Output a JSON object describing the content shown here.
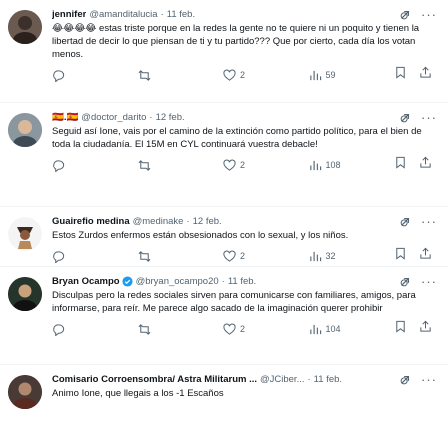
{
  "tweets": [
    {
      "name": "jennifer",
      "handle": "@amanditalucia",
      "date": "11 feb.",
      "text": "😂😂😂😂 estas triste porque en la redes la gente no te quiere ni un poquito y tienen la libertad de decir lo que piensan de ti y tu partido??? Que por cierto, cada día los votan menos.",
      "replies": "",
      "retweets": "",
      "likes": "2",
      "views": "59"
    },
    {
      "name": "🇪🇸.🇪🇸",
      "handle": "@doctor_darito",
      "date": "12 feb.",
      "text": "Seguid así Ione, vais por el camino de la extinción como partido político, para el bien de toda la ciudadanía. El 15M en CYL continuará vuestra debacle!",
      "replies": "",
      "retweets": "",
      "likes": "2",
      "views": "108"
    },
    {
      "name": "Guairefio medina",
      "handle": "@medinake",
      "date": "12 feb.",
      "text": "Estos Zurdos enfermos están obsesionados con lo sexual, y los niños.",
      "replies": "",
      "retweets": "",
      "likes": "2",
      "views": "32"
    },
    {
      "name": "Bryan Ocampo",
      "handle": "@bryan_ocampo20",
      "date": "11 feb.",
      "text": "Disculpas pero la redes sociales sirven para comunicarse con familiares, amigos, para informarse, para reír. Me parece algo sacado de la imaginación querer prohibir",
      "replies": "",
      "retweets": "",
      "likes": "2",
      "views": "104"
    },
    {
      "name": "Comisario Corroensombra/ Astra Militarum ...",
      "handle": "@JCiber...",
      "date": "11 feb.",
      "text": "Animo Ione, que llegais a los -1 Escaños",
      "replies": "",
      "retweets": "",
      "likes": "",
      "views": ""
    }
  ],
  "colors": {
    "text": "#0f1419",
    "secondary": "#536471",
    "verified": "#1d9bf0",
    "border": "#eff3f4"
  }
}
